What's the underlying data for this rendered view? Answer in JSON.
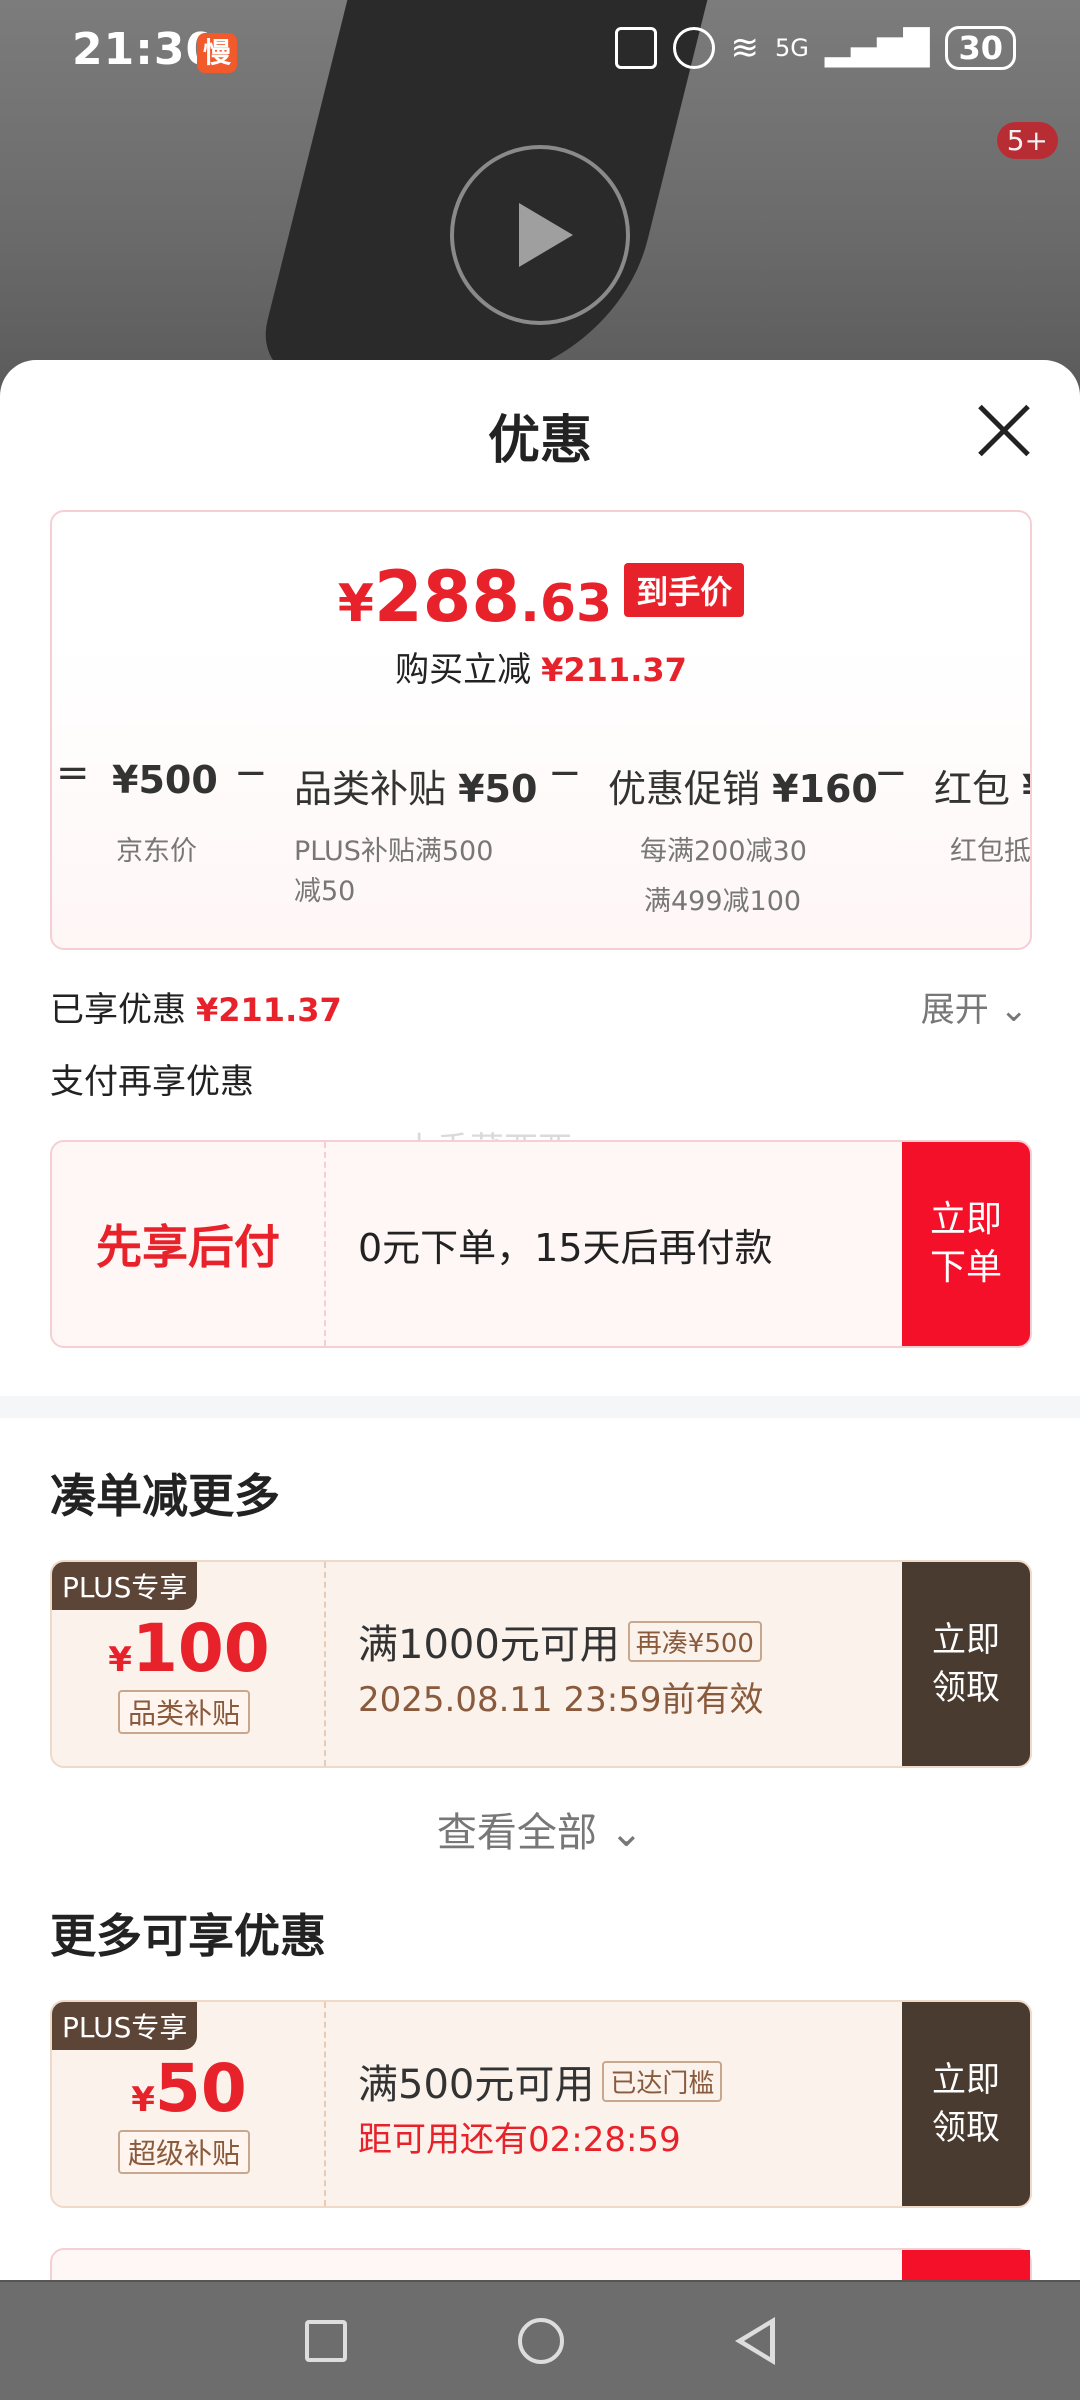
{
  "status_bar": {
    "time": "21:30",
    "slow_badge": "慢",
    "battery": "30",
    "network": "5G"
  },
  "video": {
    "badge": "5+"
  },
  "sheet": {
    "title": "优惠",
    "final_price": {
      "yen": "¥",
      "int": "288",
      "dec": ".63",
      "tag": "到手价"
    },
    "reduce": {
      "label": "购买立减",
      "amount": "¥211.37"
    },
    "breakdown": [
      {
        "amount": "¥500",
        "label": "京东价"
      },
      {
        "amount": "¥50",
        "name": "品类补贴",
        "label_lines": [
          "PLUS补贴满500",
          "减50"
        ]
      },
      {
        "amount": "¥160",
        "name": "优惠促销",
        "label_lines": [
          "每满200减30",
          "满499减100"
        ]
      },
      {
        "amount": "¥",
        "name": "红包",
        "label": "红包抵"
      }
    ],
    "enjoyed": {
      "label": "已享优惠",
      "amount": "¥211.37",
      "expand": "展开"
    },
    "pay_more": "支付再享优惠",
    "pay_card": {
      "title": "先享后付",
      "desc": "0元下单，15天后再付款",
      "button": "立即\n下单"
    },
    "watermark": "小香菜西西",
    "section1": "凑单减更多",
    "coupon1": {
      "plus": "PLUS专享",
      "yen": "¥",
      "amount": "100",
      "type": "品类补贴",
      "cond": "满1000元可用",
      "tag": "再凑¥500",
      "valid": "2025.08.11 23:59前有效",
      "button": "立即\n领取"
    },
    "view_all": "查看全部",
    "section2": "更多可享优惠",
    "coupon2": {
      "plus": "PLUS专享",
      "yen": "¥",
      "amount": "50",
      "type": "超级补贴",
      "cond": "满500元可用",
      "tag": "已达门槛",
      "countdown": "距可用还有02:28:59",
      "button": "立即\n领取"
    }
  },
  "colors": {
    "accent_red": "#e8222b",
    "coupon_btn": "#4a3b30",
    "pay_btn": "#f5102a"
  }
}
